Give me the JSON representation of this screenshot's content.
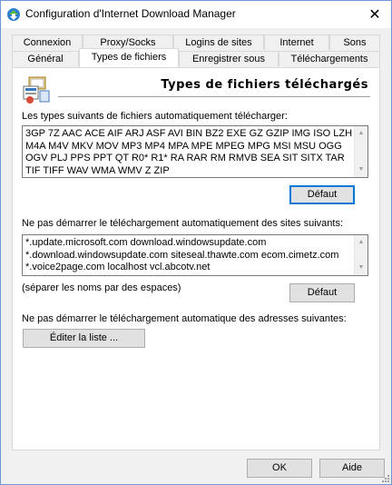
{
  "window": {
    "title": "Configuration d'Internet Download Manager",
    "close_glyph": "✕"
  },
  "tabs_row1": [
    {
      "label": "Connexion"
    },
    {
      "label": "Proxy/Socks"
    },
    {
      "label": "Logins de sites"
    },
    {
      "label": "Internet"
    },
    {
      "label": "Sons"
    }
  ],
  "tabs_row2": [
    {
      "label": "Général"
    },
    {
      "label": "Types de fichiers",
      "active": true
    },
    {
      "label": "Enregistrer sous"
    },
    {
      "label": "Téléchargements"
    }
  ],
  "panel": {
    "heading": "Types de fichiers téléchargés",
    "types_label": "Les types suivants de fichiers automatiquement télécharger:",
    "types_value": "3GP 7Z AAC ACE AIF ARJ ASF AVI BIN BZ2 EXE GZ GZIP IMG ISO LZH M4A M4V MKV MOV MP3 MP4 MPA MPE MPEG MPG MSI MSU OGG OGV PLJ PPS PPT QT R0* R1* RA RAR RM RMVB SEA SIT SITX TAR TIF TIFF WAV WMA WMV Z ZIP",
    "types_default_btn": "Défaut",
    "sites_label": "Ne pas démarrer le téléchargement automatiquement des sites suivants:",
    "sites_value": "*.update.microsoft.com download.windowsupdate.com *.download.windowsupdate.com siteseal.thawte.com ecom.cimetz.com *.voice2page.com localhost vcl.abcotv.net",
    "sites_hint": "(séparer les noms par des espaces)",
    "sites_default_btn": "Défaut",
    "addresses_label": "Ne pas démarrer le téléchargement automatique des adresses suivantes:",
    "edit_list_btn": "Éditer la liste ..."
  },
  "footer": {
    "ok_btn": "OK",
    "help_btn": "Aide"
  },
  "colors": {
    "accent": "#0078d7",
    "window_border": "#6d9ad6",
    "face": "#f0f0f0"
  }
}
